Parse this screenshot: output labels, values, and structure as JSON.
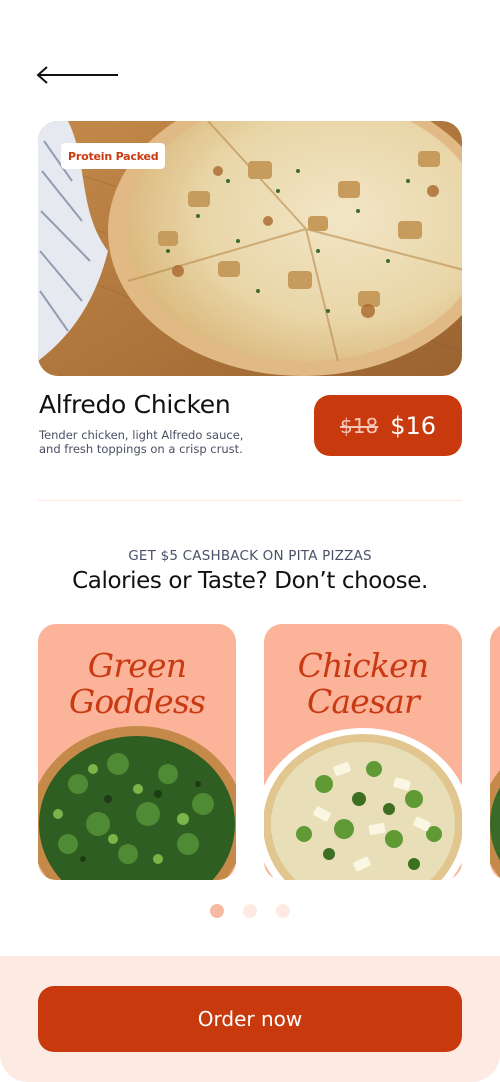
{
  "nav": {
    "back_icon": "arrow-left-icon"
  },
  "product": {
    "badge": "Protein Packed",
    "title": "Alfredo Chicken",
    "description": "Tender chicken, light Alfredo sauce, and fresh toppings on a crisp crust.",
    "old_price": "$18",
    "new_price": "$16"
  },
  "promo": {
    "kicker": "GET $5 CASHBACK ON PITA PIZZAS",
    "title": "Calories or Taste? Don’t choose."
  },
  "cards": [
    {
      "line1": "Green",
      "line2": "Goddess"
    },
    {
      "line1": "Chicken",
      "line2": "Caesar"
    }
  ],
  "carousel": {
    "total": 3,
    "active": 1
  },
  "cta": {
    "label": "Order now"
  },
  "colors": {
    "accent": "#c83a0d",
    "card_bg": "#fbb39a",
    "soft_bg": "#fdeae3"
  }
}
